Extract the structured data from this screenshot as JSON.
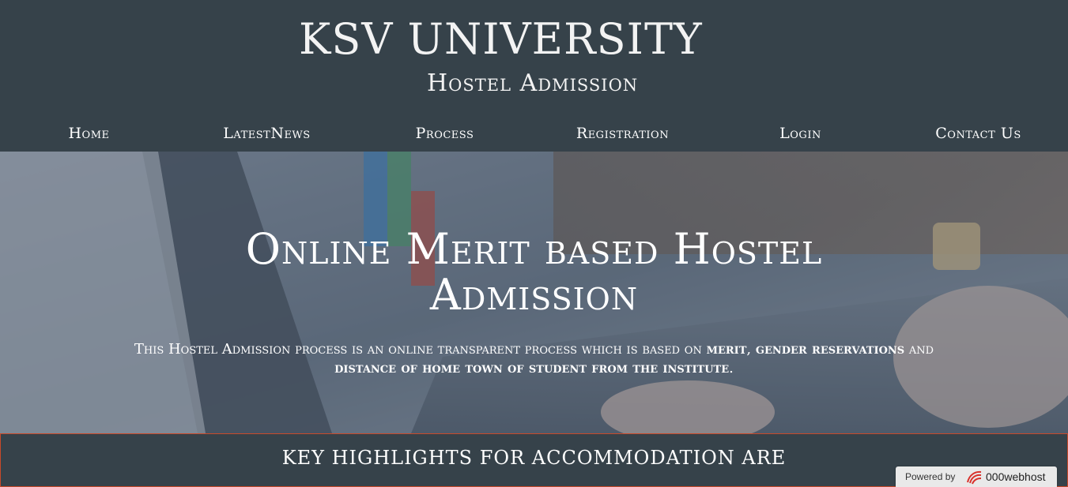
{
  "header": {
    "title": "KSV UNIVERSITY",
    "subtitle": "Hostel Admission"
  },
  "nav": {
    "items": [
      {
        "label": "Home"
      },
      {
        "label": "LatestNews"
      },
      {
        "label": "Process"
      },
      {
        "label": "Registration"
      },
      {
        "label": "Login"
      },
      {
        "label": "Contact Us"
      }
    ]
  },
  "hero": {
    "title": "Online Merit based Hostel Admission",
    "desc_intro": "This Hostel Admission process is an online transparent process which is based on ",
    "merit": "merit",
    "sep1": ", ",
    "gender": "gender reservations",
    "and": " and ",
    "distance": "distance of home town of student from the institute",
    "end": "."
  },
  "highlights": {
    "title": "KEY HIGHLIGHTS FOR ACCOMMODATION ARE"
  },
  "badge": {
    "powered_by": "Powered by",
    "brand": "000webhost",
    "logo_icon": "000webhost-logo-icon"
  },
  "colors": {
    "header_bg": "#36424a",
    "highlight_border": "#c84a2a",
    "text": "#ffffff"
  }
}
